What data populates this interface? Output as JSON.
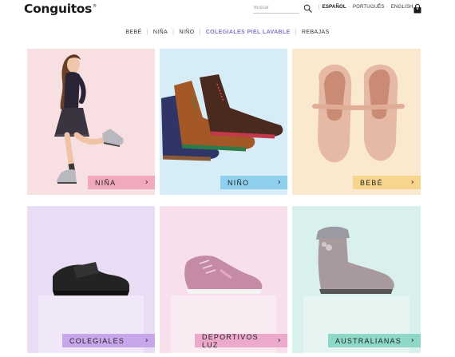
{
  "header": {
    "logo": "Conguitos",
    "logo_mark": "®",
    "search_placeholder": "Buscar",
    "languages": [
      {
        "label": "ESPAÑOL",
        "active": true
      },
      {
        "label": "PORTUGUÊS",
        "active": false
      },
      {
        "label": "ENGLISH",
        "active": false
      }
    ],
    "cart_count": "0"
  },
  "nav": {
    "items": [
      {
        "label": "BEBÉ",
        "active": false
      },
      {
        "label": "NIÑA",
        "active": false
      },
      {
        "label": "NIÑO",
        "active": false
      },
      {
        "label": "COLEGIALES PIEL LAVABLE",
        "active": true
      },
      {
        "label": "REBAJAS",
        "active": false
      }
    ]
  },
  "tiles": [
    {
      "name": "nina",
      "label": "NIÑA",
      "bg": "#f8dfe2",
      "btn": "#f2a9bd"
    },
    {
      "name": "nino",
      "label": "NIÑO",
      "bg": "#d6ecf6",
      "btn": "#8ed0ee"
    },
    {
      "name": "bebe",
      "label": "BEBÉ",
      "bg": "#fbe9cf",
      "btn": "#f8d58d"
    },
    {
      "name": "colegiales",
      "label": "COLEGIALES",
      "bg": "#e9dcf5",
      "btn": "#c7a6ea"
    },
    {
      "name": "deportivos-luz",
      "label": "DEPORTIVOS LUZ",
      "bg": "#f7dfeb",
      "btn": "#eda9cc"
    },
    {
      "name": "australianas",
      "label": "AUSTRALIANAS",
      "bg": "#d9f0ec",
      "btn": "#8ed8c8"
    }
  ],
  "arrow_glyph": "›"
}
